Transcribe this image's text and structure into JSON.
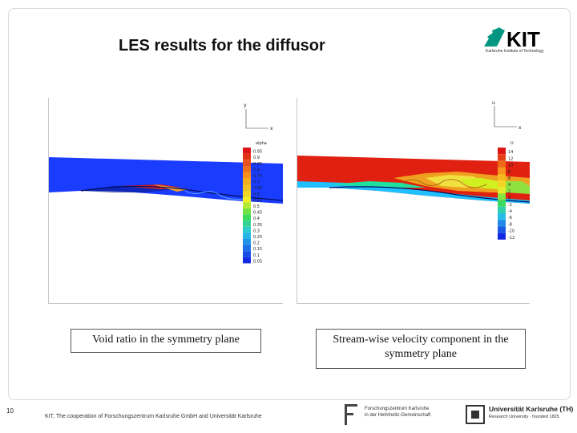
{
  "slide": {
    "title": "LES results for the diffusor",
    "page_number": "10",
    "footer_text": "KIT, The cooperation of Forschungszentrum Karlsruhe GmbH and Universität Karlsruhe"
  },
  "logos": {
    "kit": {
      "mark": "KIT",
      "tagline": "Karlsruhe Institute of Technology",
      "color": "#009682"
    },
    "fzk": {
      "line1": "Forschungszentrum Karlsruhe",
      "line2": "in der Helmholtz-Gemeinschaft"
    },
    "uka": {
      "name": "Universität Karlsruhe (TH)",
      "tagline": "Research University · founded 1825"
    }
  },
  "left_plot": {
    "caption": "Void ratio in the symmetry plane",
    "axis_y": "y",
    "axis_x": "x",
    "legend_title": "alpha",
    "legend_values": [
      "0.95",
      "0.9",
      "0.85",
      "0.8",
      "0.75",
      "0.7",
      "0.65",
      "0.6",
      "0.55",
      "0.5",
      "0.45",
      "0.4",
      "0.35",
      "0.3",
      "0.25",
      "0.2",
      "0.15",
      "0.1",
      "0.05"
    ]
  },
  "right_plot": {
    "caption": "Stream-wise velocity component in the symmetry plane",
    "axis_y": "u",
    "axis_x": "x",
    "legend_title": "U",
    "legend_values": [
      "14",
      "12",
      "10",
      "8",
      "6",
      "4",
      "2",
      "0",
      "-2",
      "-4",
      "-6",
      "-8",
      "-10",
      "-12"
    ]
  }
}
